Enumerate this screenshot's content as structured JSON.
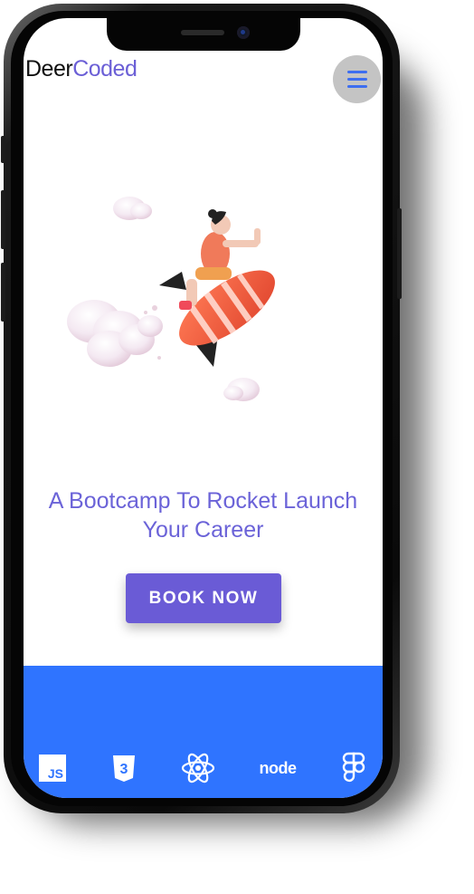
{
  "brand": {
    "part1": "Deer",
    "part2": "Coded"
  },
  "nav": {
    "menu_icon": "hamburger-icon"
  },
  "hero": {
    "image": "rocket-rider-illustration",
    "headline_line1": "A Bootcamp To Rocket Launch",
    "headline_line2": "Your Career",
    "cta_label": "BOOK NOW"
  },
  "tech_stack": {
    "js_label": "JS",
    "node_label": "node",
    "icons": [
      "javascript-icon",
      "css3-icon",
      "react-icon",
      "nodejs-icon",
      "figma-icon"
    ]
  },
  "colors": {
    "brand_purple": "#6b5fd6",
    "cta_bg": "#6a5bd6",
    "band_blue": "#2f74ff",
    "menu_circle": "#c4c4c4"
  }
}
